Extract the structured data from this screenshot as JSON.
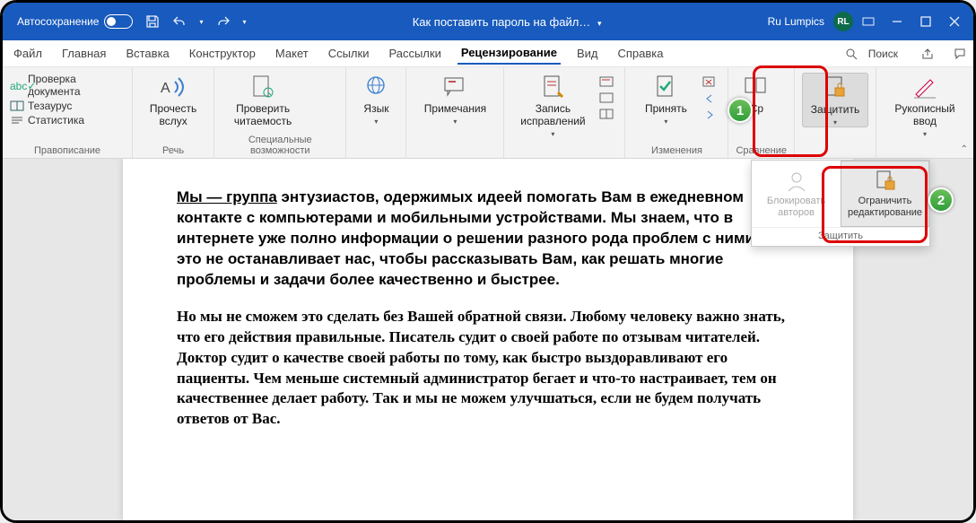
{
  "title_bar": {
    "autosave": "Автосохранение",
    "doc_title": "Как поставить пароль на файл…",
    "doc_dropdown": "▾",
    "user_name": "Ru Lumpics",
    "user_initials": "RL"
  },
  "tabs": {
    "items": [
      "Файл",
      "Главная",
      "Вставка",
      "Конструктор",
      "Макет",
      "Ссылки",
      "Рассылки",
      "Рецензирование",
      "Вид",
      "Справка"
    ],
    "active_index": 7,
    "search_label": "Поиск"
  },
  "ribbon": {
    "groups": {
      "spelling": {
        "check_doc": "Проверка документа",
        "thesaurus": "Тезаурус",
        "statistics": "Статистика",
        "label": "Правописание"
      },
      "speech": {
        "read_aloud": "Прочесть вслух",
        "label": "Речь"
      },
      "accessibility": {
        "check_readability": "Проверить читаемость",
        "label": "Специальные возможности"
      },
      "language": {
        "btn": "Язык"
      },
      "comments": {
        "btn": "Примечания"
      },
      "tracking": {
        "track_changes": "Запись исправлений",
        "accept": "Принять",
        "label": "Изменения"
      },
      "compare": {
        "btn": "Ср",
        "label": "Сравнение"
      },
      "protect": {
        "btn": "Защитить"
      },
      "ink": {
        "btn": "Рукописный ввод"
      }
    },
    "protect_dropdown": {
      "block_authors": "Блокировать авторов",
      "restrict_editing": "Ограничить редактирование",
      "footer": "Защитить"
    }
  },
  "callouts": {
    "b1": "1",
    "b2": "2"
  },
  "document": {
    "p1_link": "Мы — группа",
    "p1_rest": " энтузиастов, одержимых идеей помогать Вам в ежедневном контакте с компьютерами и мобильными устройствами. Мы знаем, что в интернете уже полно информации о решении разного рода проблем с ними. Но это не останавливает нас, чтобы рассказывать Вам, как решать многие проблемы и задачи более качественно и быстрее.",
    "p2": "Но мы не сможем это сделать без Вашей обратной связи. Любому человеку важно знать, что его действия правильные. Писатель судит о своей работе по отзывам читателей. Доктор судит о качестве своей работы по тому, как быстро выздоравливают его пациенты. Чем меньше системный администратор бегает и что-то настраивает, тем он качественнее делает работу. Так и мы не можем улучшаться, если не будем получать ответов от Вас."
  }
}
